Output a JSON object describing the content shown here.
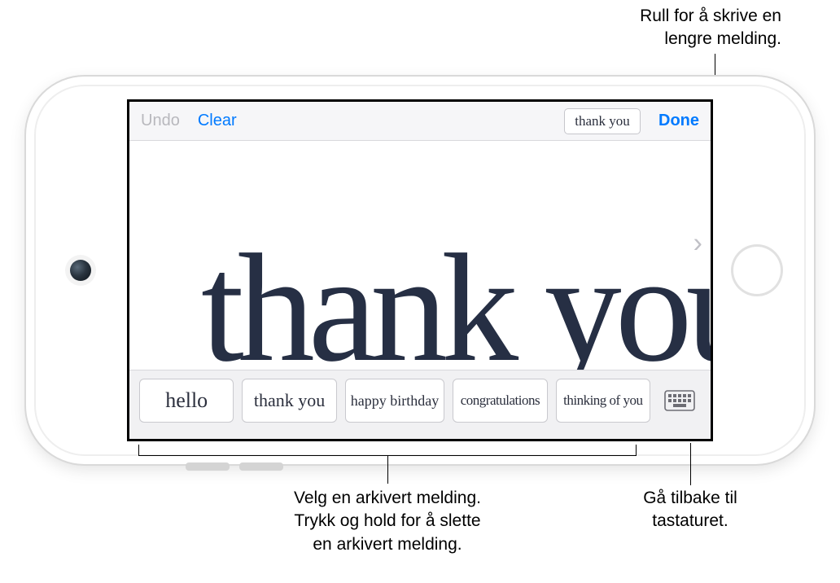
{
  "callouts": {
    "scroll": "Rull for å skrive en\nlengre melding.",
    "saved": "Velg en arkivert melding.\nTrykk og hold for å slette\nen arkivert melding.",
    "keyboard": "Gå tilbake til\ntastaturet."
  },
  "toolbar": {
    "undo": "Undo",
    "clear": "Clear",
    "preview": "thank you",
    "done": "Done"
  },
  "canvas": {
    "text": "thank you"
  },
  "saved": [
    "hello",
    "thank you",
    "happy birthday",
    "congratulations",
    "thinking of you"
  ]
}
